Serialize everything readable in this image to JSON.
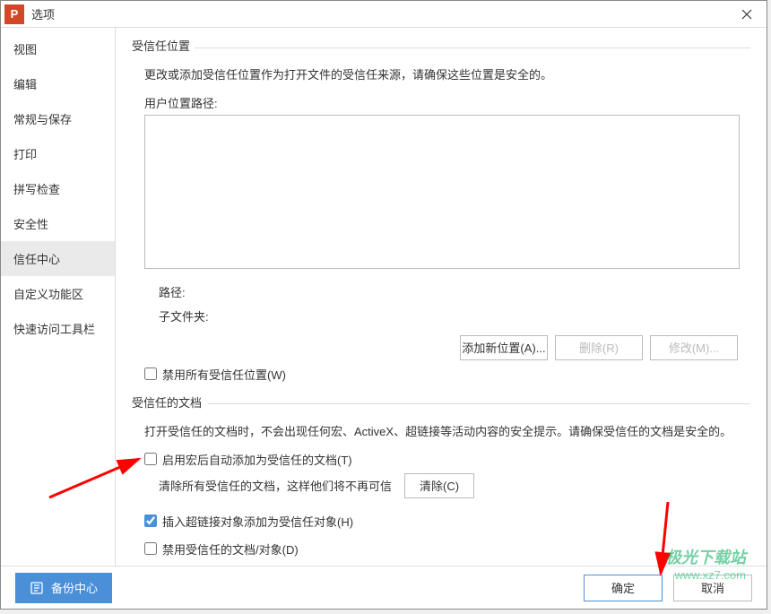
{
  "title": "选项",
  "sidebar": {
    "items": [
      {
        "label": "视图"
      },
      {
        "label": "编辑"
      },
      {
        "label": "常规与保存"
      },
      {
        "label": "打印"
      },
      {
        "label": "拼写检查"
      },
      {
        "label": "安全性"
      },
      {
        "label": "信任中心"
      },
      {
        "label": "自定义功能区"
      },
      {
        "label": "快速访问工具栏"
      }
    ]
  },
  "trusted_location": {
    "section_title": "受信任位置",
    "description": "更改或添加受信任位置作为打开文件的受信任来源，请确保这些位置是安全的。",
    "user_path_label": "用户位置路径:",
    "path_label": "路径:",
    "subfolder_label": "子文件夹:",
    "add_btn": "添加新位置(A)...",
    "delete_btn": "删除(R)",
    "modify_btn": "修改(M)...",
    "disable_checkbox": "禁用所有受信任位置(W)"
  },
  "trusted_doc": {
    "section_title": "受信任的文档",
    "description": "打开受信任的文档时，不会出现任何宏、ActiveX、超链接等活动内容的安全提示。请确保受信任的文档是安全的。",
    "enable_macro": "启用宏后自动添加为受信任的文档(T)",
    "clear_text": "清除所有受信任的文档，这样他们将不再可信",
    "clear_btn": "清除(C)",
    "hyperlink_checkbox": "插入超链接对象添加为受信任对象(H)",
    "disable_doc": "禁用受信任的文档/对象(D)"
  },
  "footer": {
    "backup_center": "备份中心",
    "ok": "确定",
    "cancel": "取消"
  },
  "watermark": {
    "title": "极光下载站",
    "url": "www.xz7.com"
  }
}
